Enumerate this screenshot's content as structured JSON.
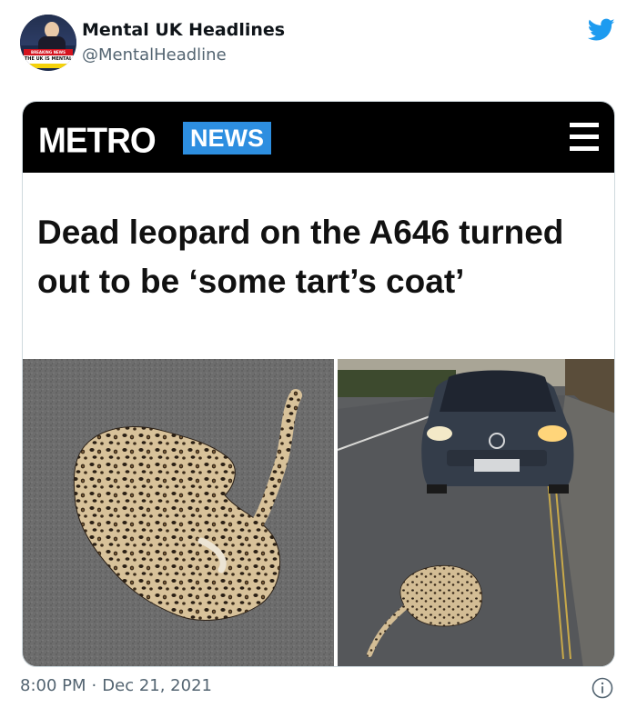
{
  "tweet": {
    "display_name": "Mental UK Headlines",
    "handle": "@MentalHeadline",
    "time": "8:00 PM",
    "separator": "·",
    "date": "Dec 21, 2021"
  },
  "avatar": {
    "banner_text": "BREAKING NEWS",
    "strap_text": "THE UK IS MENTAL"
  },
  "article": {
    "brand": "METRO",
    "section": "NEWS",
    "headline": "Dead leopard on the A646 turned out to be ‘some tart’s coat’",
    "images": [
      "leopard-print-coat-closeup",
      "coat-in-road-in-front-of-car"
    ]
  },
  "icons": {
    "twitter": "twitter-bird-icon",
    "menu": "hamburger-menu-icon",
    "info": "info-icon"
  },
  "colors": {
    "twitter_blue": "#1d9bf0",
    "metro_black": "#000000",
    "news_blue": "#2d8ee0",
    "meta_gray": "#536471"
  }
}
